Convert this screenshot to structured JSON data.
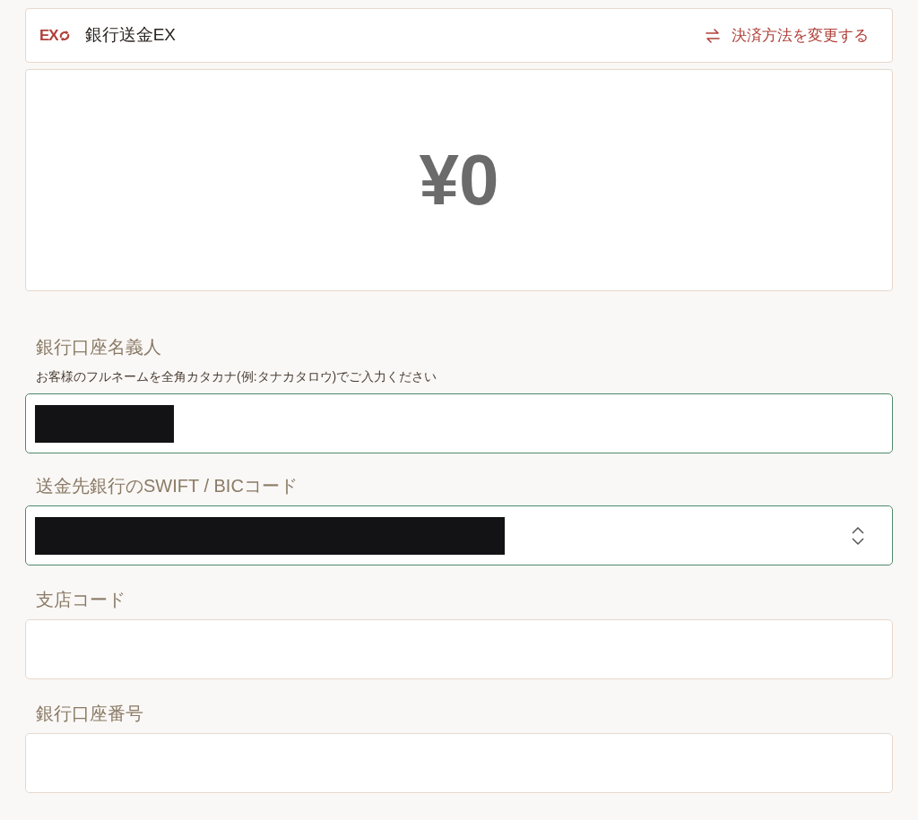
{
  "header": {
    "logo": "EX",
    "title": "銀行送金EX",
    "change_link": "決済方法を変更する"
  },
  "amount": "¥0",
  "fields": [
    {
      "kind": "text",
      "label": "銀行口座名義人",
      "hint": "お客様のフルネームを全角カタカナ(例:タナカタロウ)でご入力ください",
      "redacted": true,
      "filled": true
    },
    {
      "kind": "select",
      "label": "送金先銀行のSWIFT / BICコード",
      "redacted": true,
      "filled": true
    },
    {
      "kind": "text",
      "label": "支店コード",
      "redacted": false,
      "filled": false
    },
    {
      "kind": "text",
      "label": "銀行口座番号",
      "redacted": false,
      "filled": false
    }
  ]
}
